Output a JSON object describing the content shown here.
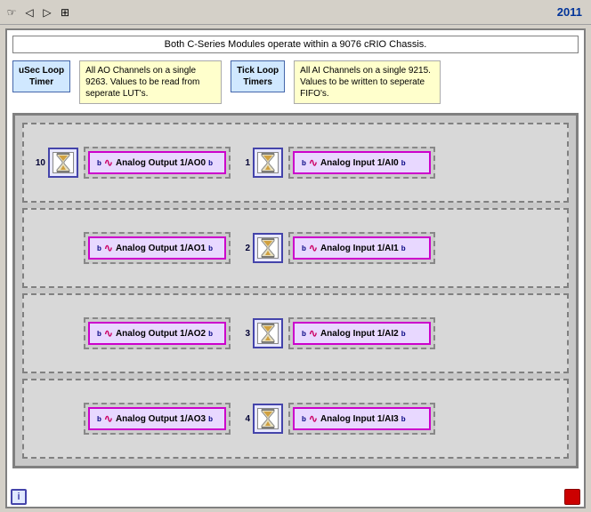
{
  "toolbar": {
    "year": "2011",
    "icons": [
      "hand",
      "back",
      "forward",
      "grid"
    ]
  },
  "banner": {
    "text": "Both C-Series Modules operate within a 9076 cRIO Chassis."
  },
  "legend": {
    "usec_label": "uSec Loop\nTimer",
    "ao_desc": "All AO Channels on a single 9263.  Values to be read from seperate LUT's.",
    "tick_label": "Tick Loop\nTimers",
    "ai_desc": "All AI Channels on a single 9215.  Values to be written to seperate FIFO's."
  },
  "rows": [
    {
      "timer_num": "10",
      "tick_num": "1",
      "ao_label": "Analog Output 1/AO0",
      "ai_label": "Analog Input 1/AI0"
    },
    {
      "timer_num": "",
      "tick_num": "2",
      "ao_label": "Analog Output 1/AO1",
      "ai_label": "Analog Input 1/AI1"
    },
    {
      "timer_num": "",
      "tick_num": "3",
      "ao_label": "Analog Output 1/AO2",
      "ai_label": "Analog Input 1/AI2"
    },
    {
      "timer_num": "",
      "tick_num": "4",
      "ao_label": "Analog Output 1/AO3",
      "ai_label": "Analog Input 1/AI3"
    }
  ]
}
